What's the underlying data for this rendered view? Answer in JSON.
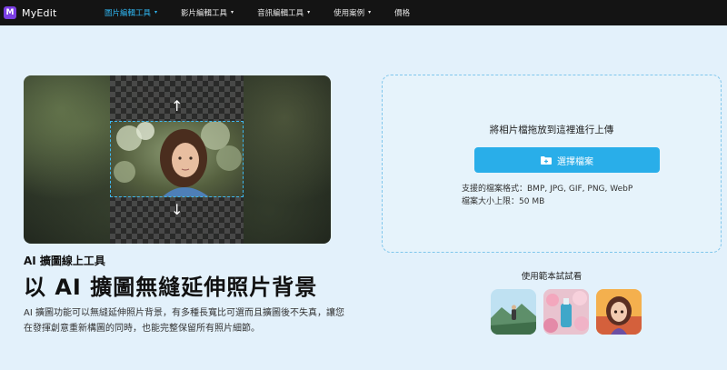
{
  "brand": {
    "name": "MyEdit",
    "logo_letter": "M"
  },
  "nav": {
    "items": [
      {
        "label": "圖片編輯工具",
        "has_dropdown": true,
        "active": true
      },
      {
        "label": "影片編輯工具",
        "has_dropdown": true,
        "active": false
      },
      {
        "label": "音訊編輯工具",
        "has_dropdown": true,
        "active": false
      },
      {
        "label": "使用案例",
        "has_dropdown": true,
        "active": false
      },
      {
        "label": "價格",
        "has_dropdown": false,
        "active": false
      }
    ]
  },
  "hero": {
    "eyebrow": "AI 擴圖線上工具",
    "headline": "以 AI 擴圖無縫延伸照片背景",
    "description": "AI 擴圖功能可以無縫延伸照片背景，有多種長寬比可選而且擴圖後不失真，讓您在發揮創意重新構圖的同時，也能完整保留所有照片細節。",
    "arrow_up": "↑",
    "arrow_down": "↓"
  },
  "upload": {
    "title": "將相片檔拖放到這裡進行上傳",
    "button_label": "選擇檔案",
    "formats_line": "支援的檔案格式：BMP, JPG, GIF, PNG, WebP",
    "size_line": "檔案大小上限：50 MB"
  },
  "samples": {
    "label": "使用範本試試看",
    "items": [
      {
        "name": "hiker-mountain-sample"
      },
      {
        "name": "bottle-flowers-sample"
      },
      {
        "name": "cartoon-girl-sample"
      }
    ]
  },
  "colors": {
    "accent": "#29aee9",
    "nav_active": "#2fb5f0",
    "topbar": "#141414",
    "background": "#e3f1fb"
  }
}
